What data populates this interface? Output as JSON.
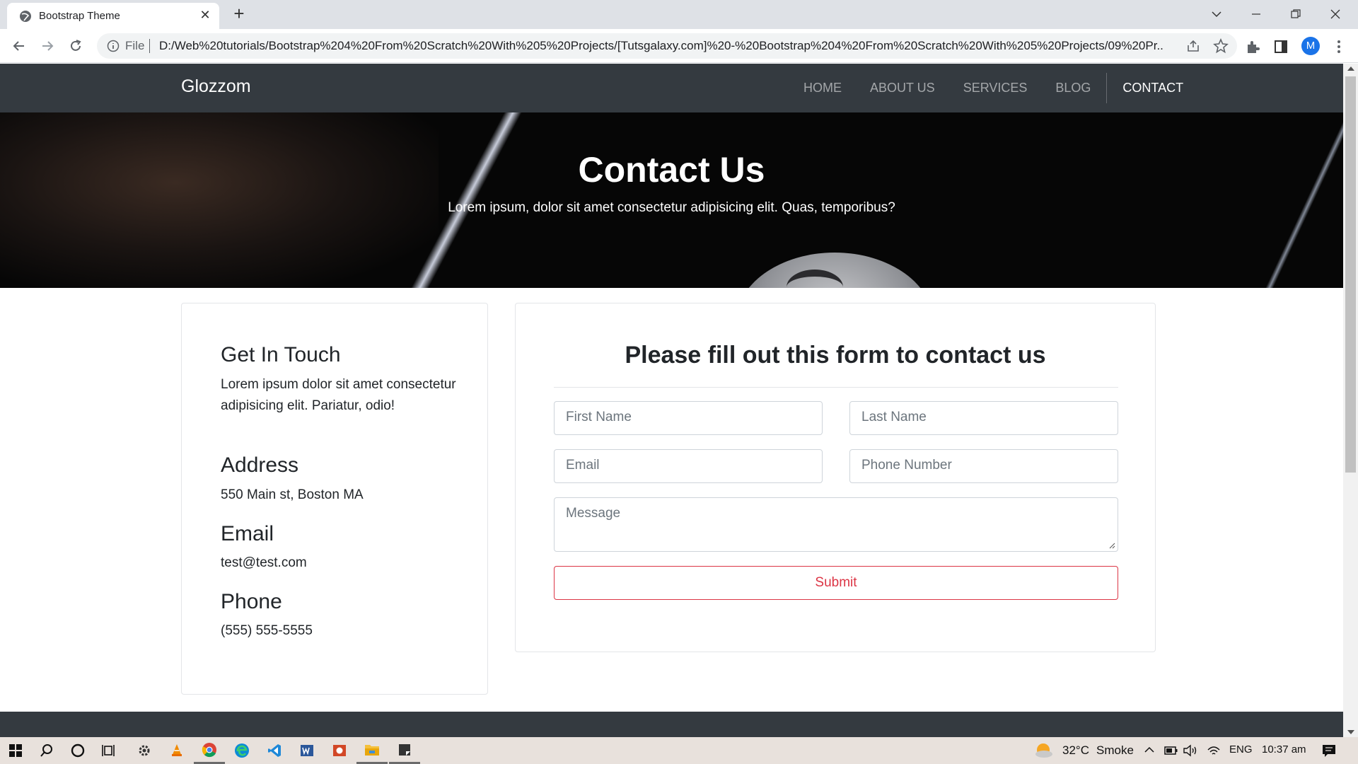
{
  "browser": {
    "tab_title": "Bootstrap Theme",
    "new_tab_symbol": "+",
    "close_symbol": "✕",
    "address_scheme": "File",
    "url": "D:/Web%20tutorials/Bootstrap%204%20From%20Scratch%20With%205%20Projects/[Tutsgalaxy.com]%20-%20Bootstrap%204%20From%20Scratch%20With%205%20Projects/09%20Pr...",
    "profile_initial": "M"
  },
  "site": {
    "brand": "Glozzom",
    "nav": [
      {
        "label": "HOME"
      },
      {
        "label": "ABOUT US"
      },
      {
        "label": "SERVICES"
      },
      {
        "label": "BLOG"
      },
      {
        "label": "CONTACT"
      }
    ],
    "hero": {
      "title": "Contact Us",
      "subtitle": "Lorem ipsum, dolor sit amet consectetur adipisicing elit. Quas, temporibus?"
    },
    "info": {
      "touch_heading": "Get In Touch",
      "touch_text": "Lorem ipsum dolor sit amet consectetur adipisicing elit. Pariatur, odio!",
      "address_heading": "Address",
      "address_text": "550 Main st, Boston MA",
      "email_heading": "Email",
      "email_text": "test@test.com",
      "phone_heading": "Phone",
      "phone_text": "(555) 555-5555"
    },
    "form": {
      "title": "Please fill out this form to contact us",
      "first_name_placeholder": "First Name",
      "last_name_placeholder": "Last Name",
      "email_placeholder": "Email",
      "phone_placeholder": "Phone Number",
      "message_placeholder": "Message",
      "submit_label": "Submit"
    }
  },
  "taskbar": {
    "temperature": "32°C",
    "weather": "Smoke",
    "language": "ENG",
    "time": "10:37 am"
  },
  "colors": {
    "navbar_bg": "#343a40",
    "danger": "#dc3545",
    "browser_frame": "#dee1e6"
  }
}
